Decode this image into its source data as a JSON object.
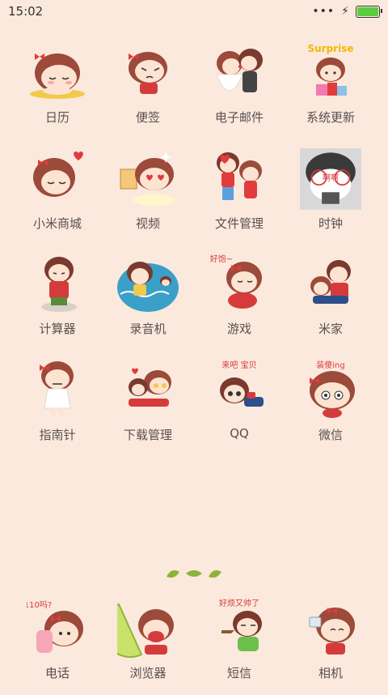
{
  "status": {
    "time": "15:02"
  },
  "colors": {
    "background": "#fbe9dd",
    "hair": "#9c4a3a",
    "skin": "#fde3d2",
    "bow": "#e23b3b",
    "battery": "#5ccc3f"
  },
  "apps": [
    {
      "label": "日历",
      "icon": "girl-sleeping-icon"
    },
    {
      "label": "便签",
      "icon": "girl-grumpy-icon"
    },
    {
      "label": "电子邮件",
      "icon": "couple-kiss-icon"
    },
    {
      "label": "系统更新",
      "icon": "girl-surprise-icon",
      "sticker": "Surprise"
    },
    {
      "label": "小米商城",
      "icon": "girl-hearts-icon"
    },
    {
      "label": "视频",
      "icon": "girl-heart-eyes-icon"
    },
    {
      "label": "文件管理",
      "icon": "couple-standing-icon"
    },
    {
      "label": "时钟",
      "icon": "masked-face-icon",
      "sticker": "啊啊"
    },
    {
      "label": "计算器",
      "icon": "boy-sitting-icon"
    },
    {
      "label": "录音机",
      "icon": "boy-swimming-icon"
    },
    {
      "label": "游戏",
      "icon": "girl-sitting-icon",
      "sticker": "好饱~"
    },
    {
      "label": "米家",
      "icon": "couple-hug-icon"
    },
    {
      "label": "指南针",
      "icon": "girl-standing-icon"
    },
    {
      "label": "下载管理",
      "icon": "couple-lying-icon"
    },
    {
      "label": "QQ",
      "icon": "boy-lying-icon",
      "sticker": "来吧 宝贝"
    },
    {
      "label": "微信",
      "icon": "girl-cute-icon",
      "sticker": "装傻ing"
    }
  ],
  "dock": [
    {
      "label": "电话",
      "icon": "girl-phone-icon",
      "sticker": "110吗?"
    },
    {
      "label": "浏览器",
      "icon": "girl-lemon-icon"
    },
    {
      "label": "短信",
      "icon": "boy-pipe-icon",
      "sticker": "好烦又帅了"
    },
    {
      "label": "相机",
      "icon": "girl-camera-icon"
    }
  ]
}
